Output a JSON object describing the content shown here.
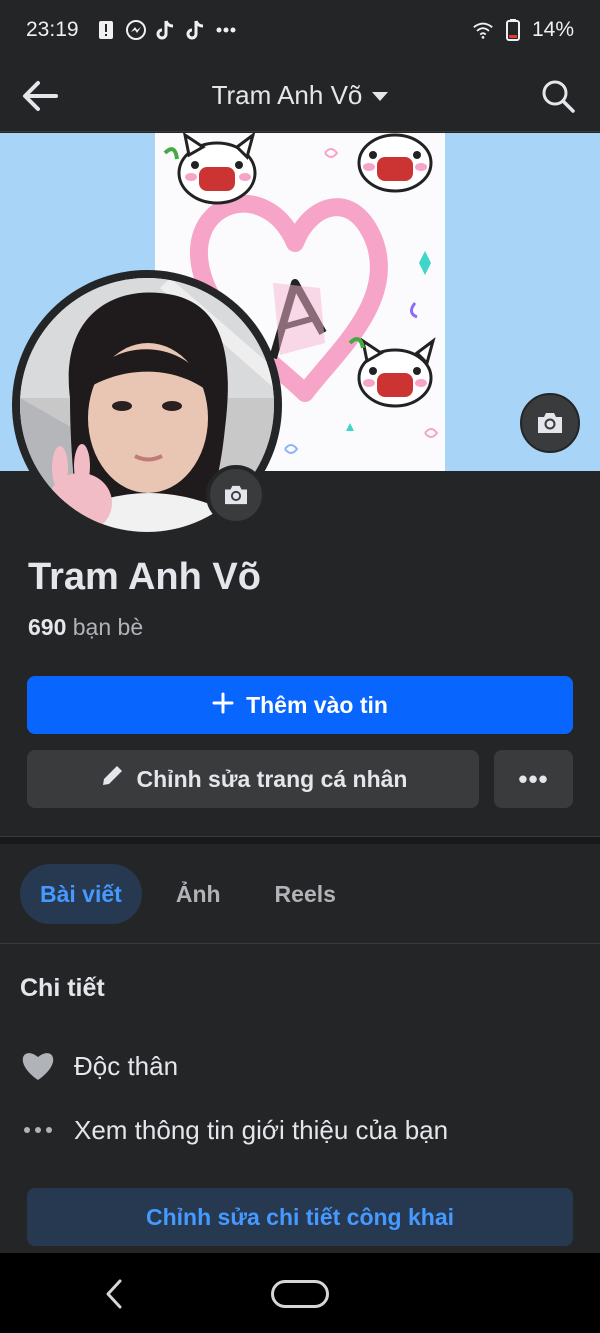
{
  "status_bar": {
    "time": "23:19",
    "battery": "14%",
    "icons_left": [
      "alert-icon",
      "messenger-icon",
      "tiktok-icon",
      "tiktok-icon",
      "more-dots-icon"
    ],
    "icons_right": [
      "wifi-icon",
      "battery-icon"
    ]
  },
  "header": {
    "title": "Tram Anh Võ"
  },
  "profile": {
    "name": "Tram Anh Võ",
    "friend_count": "690",
    "friends_label": "bạn bè"
  },
  "actions": {
    "add_story": "Thêm vào tin",
    "edit_profile": "Chỉnh sửa trang cá nhân",
    "more": "•••"
  },
  "tabs": [
    {
      "label": "Bài viết",
      "active": true
    },
    {
      "label": "Ảnh",
      "active": false
    },
    {
      "label": "Reels",
      "active": false
    }
  ],
  "details": {
    "title": "Chi tiết",
    "relationship": "Độc thân",
    "see_about": "Xem thông tin giới thiệu của bạn",
    "edit_public": "Chỉnh sửa chi tiết công khai"
  },
  "colors": {
    "background": "#242526",
    "primary": "#0866ff",
    "accent_text": "#4599ff",
    "accent_bg": "#263951",
    "cover_sky": "#a8d4f7"
  }
}
